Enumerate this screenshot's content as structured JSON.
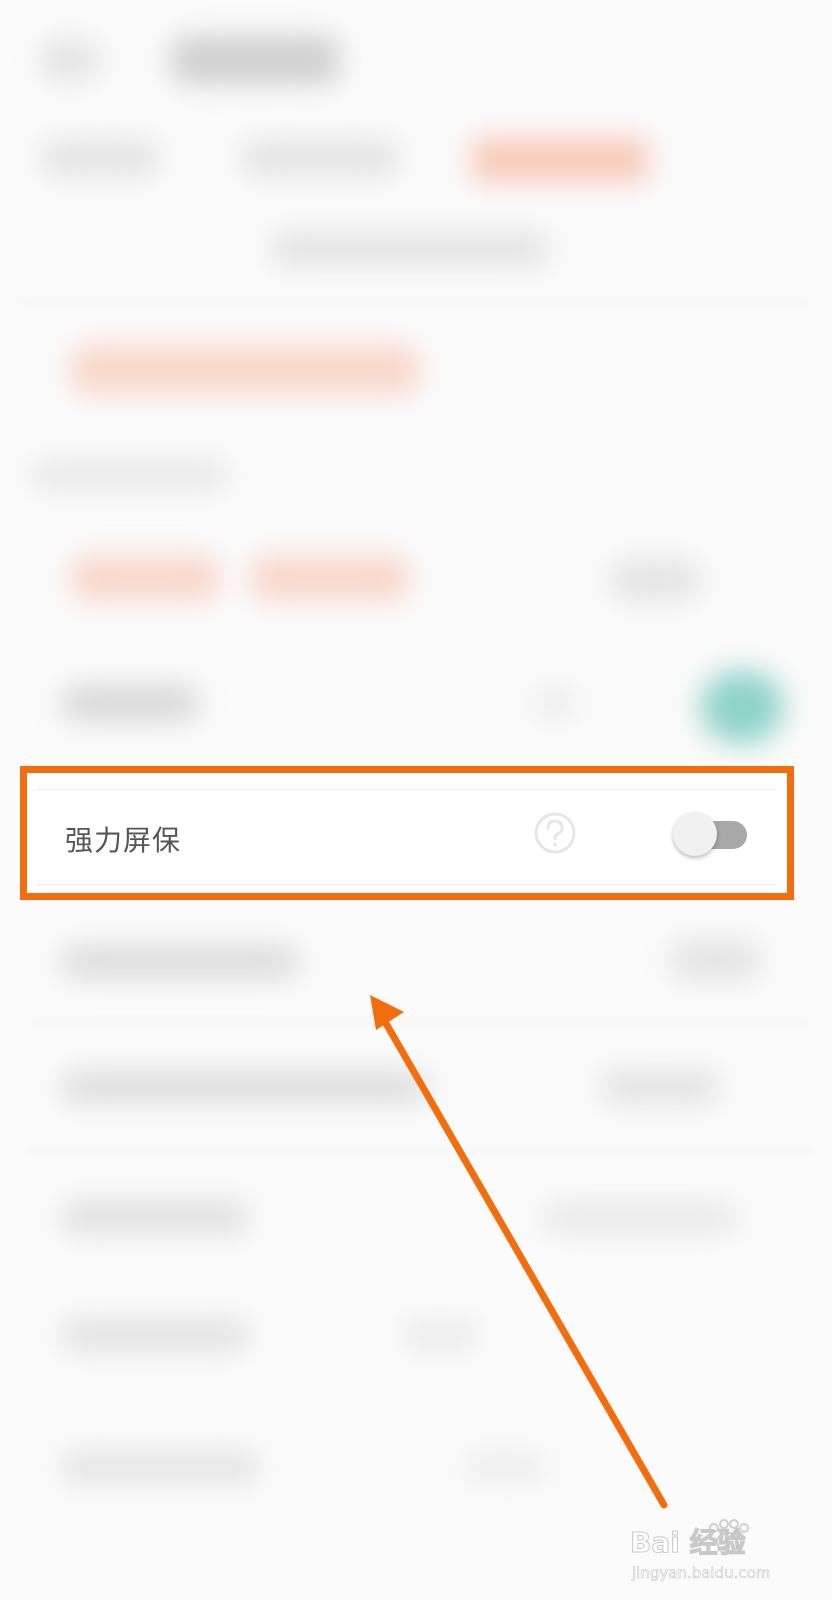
{
  "setting_row": {
    "label": "强力屏保",
    "toggle_on": false
  },
  "colors": {
    "highlight": "#f26d0c",
    "arrow": "#f26d0c",
    "toggle_track": "#a8a8a8",
    "toggle_knob": "#f1f1f1",
    "label_text": "#555555"
  },
  "icons": {
    "help": "question-circle-icon",
    "toggle": "toggle-switch",
    "watermark": "baidu-jingyan-logo"
  },
  "watermark": {
    "logo_text": "Bai 经验",
    "url_text": "jingyan.baidu.com"
  }
}
